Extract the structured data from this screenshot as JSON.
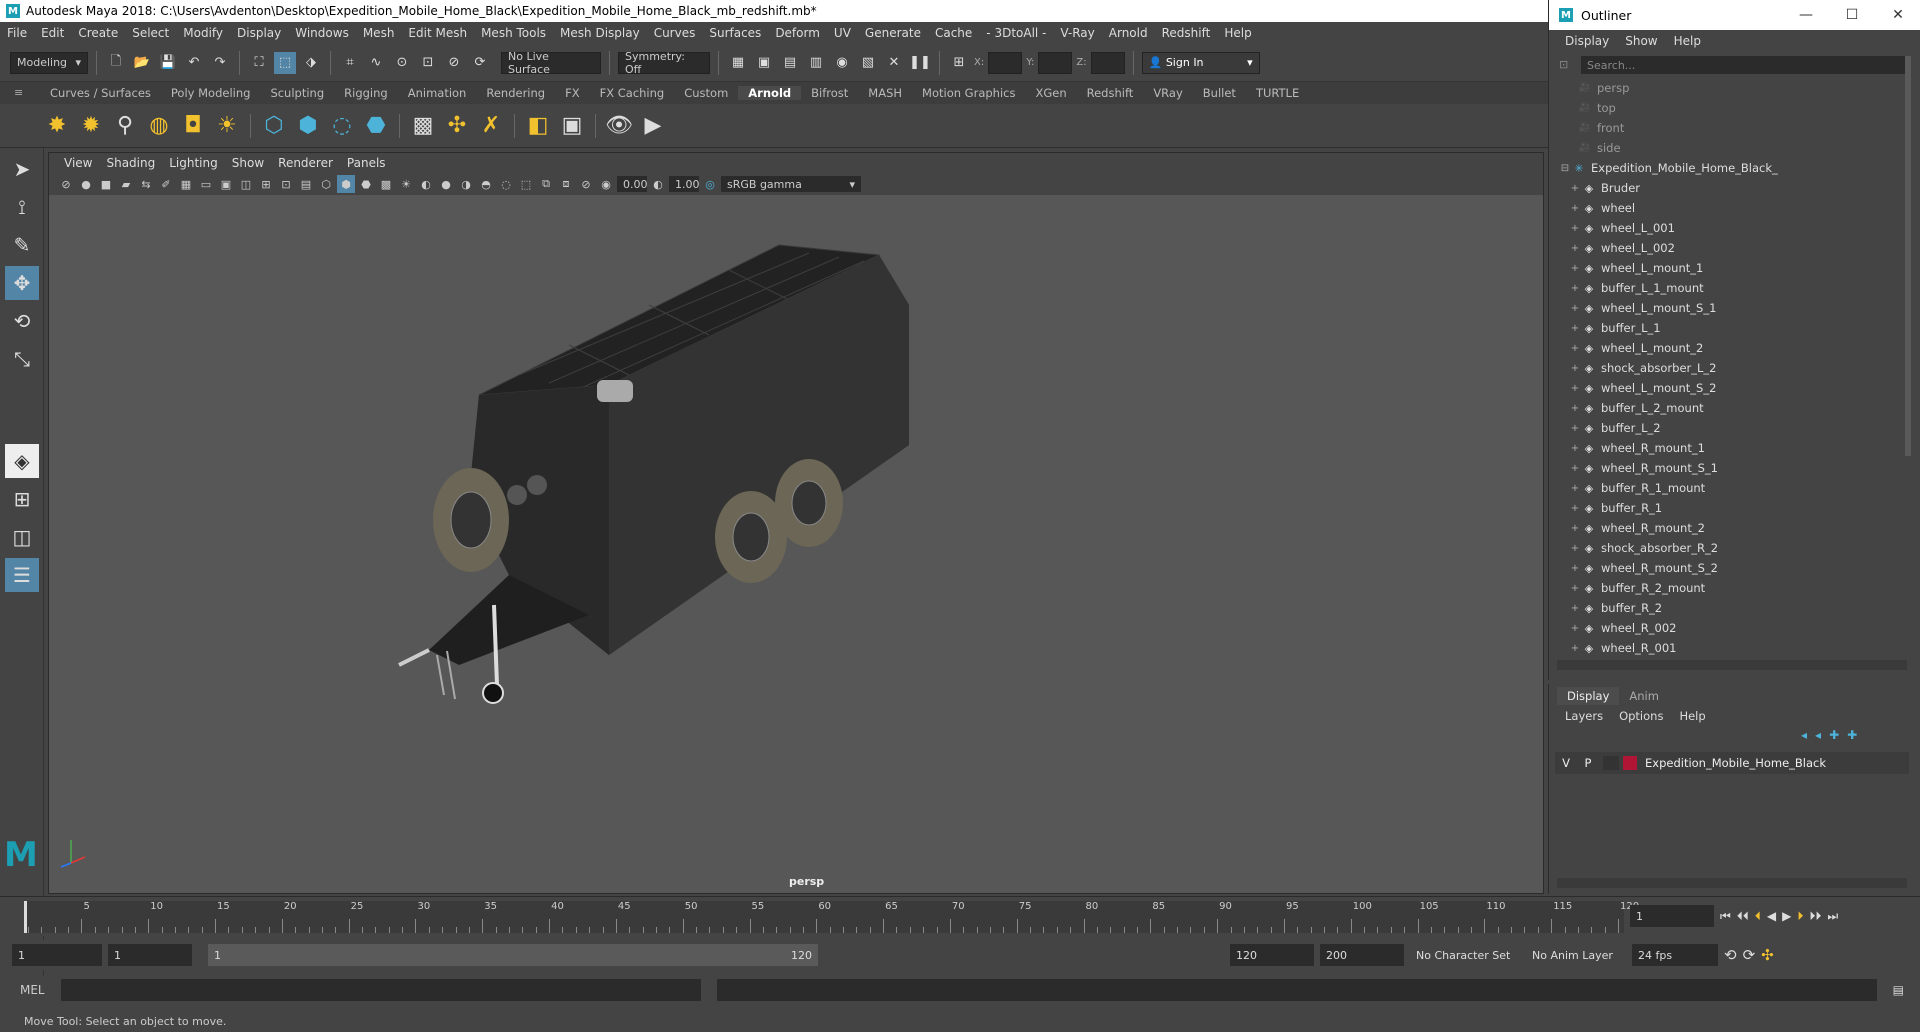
{
  "window": {
    "title": "Autodesk Maya 2018: C:\\Users\\Avdenton\\Desktop\\Expedition_Mobile_Home_Black\\Expedition_Mobile_Home_Black_mb_redshift.mb*"
  },
  "menubar": [
    "File",
    "Edit",
    "Create",
    "Select",
    "Modify",
    "Display",
    "Windows",
    "Mesh",
    "Edit Mesh",
    "Mesh Tools",
    "Mesh Display",
    "Curves",
    "Surfaces",
    "Deform",
    "UV",
    "Generate",
    "Cache",
    "- 3DtoAll -",
    "V-Ray",
    "Arnold",
    "Redshift",
    "Help"
  ],
  "statusline": {
    "workspace": "Modeling",
    "live_surface": "No Live Surface",
    "symmetry": "Symmetry: Off",
    "x_label": "X:",
    "y_label": "Y:",
    "z_label": "Z:",
    "sign_in": "Sign In"
  },
  "shelf_tabs": [
    "Curves / Surfaces",
    "Poly Modeling",
    "Sculpting",
    "Rigging",
    "Animation",
    "Rendering",
    "FX",
    "FX Caching",
    "Custom",
    "Arnold",
    "Bifrost",
    "MASH",
    "Motion Graphics",
    "XGen",
    "Redshift",
    "VRay",
    "Bullet",
    "TURTLE"
  ],
  "active_shelf_tab": "Arnold",
  "viewport": {
    "menu": [
      "View",
      "Shading",
      "Lighting",
      "Show",
      "Renderer",
      "Panels"
    ],
    "exposure": "0.00",
    "gamma": "1.00",
    "color_space": "sRGB gamma",
    "camera_label": "persp"
  },
  "outliner": {
    "title": "Outliner",
    "menu": [
      "Display",
      "Show",
      "Help"
    ],
    "search_placeholder": "Search...",
    "cameras": [
      "persp",
      "top",
      "front",
      "side"
    ],
    "group": "Expedition_Mobile_Home_Black_",
    "children": [
      "Bruder",
      "wheel",
      "wheel_L_001",
      "wheel_L_002",
      "wheel_L_mount_1",
      "buffer_L_1_mount",
      "wheel_L_mount_S_1",
      "buffer_L_1",
      "wheel_L_mount_2",
      "shock_absorber_L_2",
      "wheel_L_mount_S_2",
      "buffer_L_2_mount",
      "buffer_L_2",
      "wheel_R_mount_1",
      "wheel_R_mount_S_1",
      "buffer_R_1_mount",
      "buffer_R_1",
      "wheel_R_mount_2",
      "shock_absorber_R_2",
      "wheel_R_mount_S_2",
      "buffer_R_2_mount",
      "buffer_R_2",
      "wheel_R_002",
      "wheel_R_001"
    ]
  },
  "layers": {
    "tabs": [
      "Display",
      "Anim"
    ],
    "menu": [
      "Layers",
      "Options",
      "Help"
    ],
    "row": {
      "v": "V",
      "p": "P",
      "name": "Expedition_Mobile_Home_Black",
      "color": "#b01535"
    }
  },
  "timeline": {
    "ticks": [
      "5",
      "10",
      "15",
      "20",
      "25",
      "30",
      "35",
      "40",
      "45",
      "50",
      "55",
      "60",
      "65",
      "70",
      "75",
      "80",
      "85",
      "90",
      "95",
      "100",
      "105",
      "110",
      "115",
      "120"
    ],
    "current_frame": "1"
  },
  "range": {
    "start": "1",
    "playback_start": "1",
    "slider_start": "1",
    "slider_end": "120",
    "playback_end": "120",
    "end": "200",
    "character_set": "No Character Set",
    "anim_layer": "No Anim Layer",
    "fps": "24 fps"
  },
  "cmdline": {
    "label": "MEL"
  },
  "helpline": {
    "text": "Move Tool: Select an object to move."
  }
}
